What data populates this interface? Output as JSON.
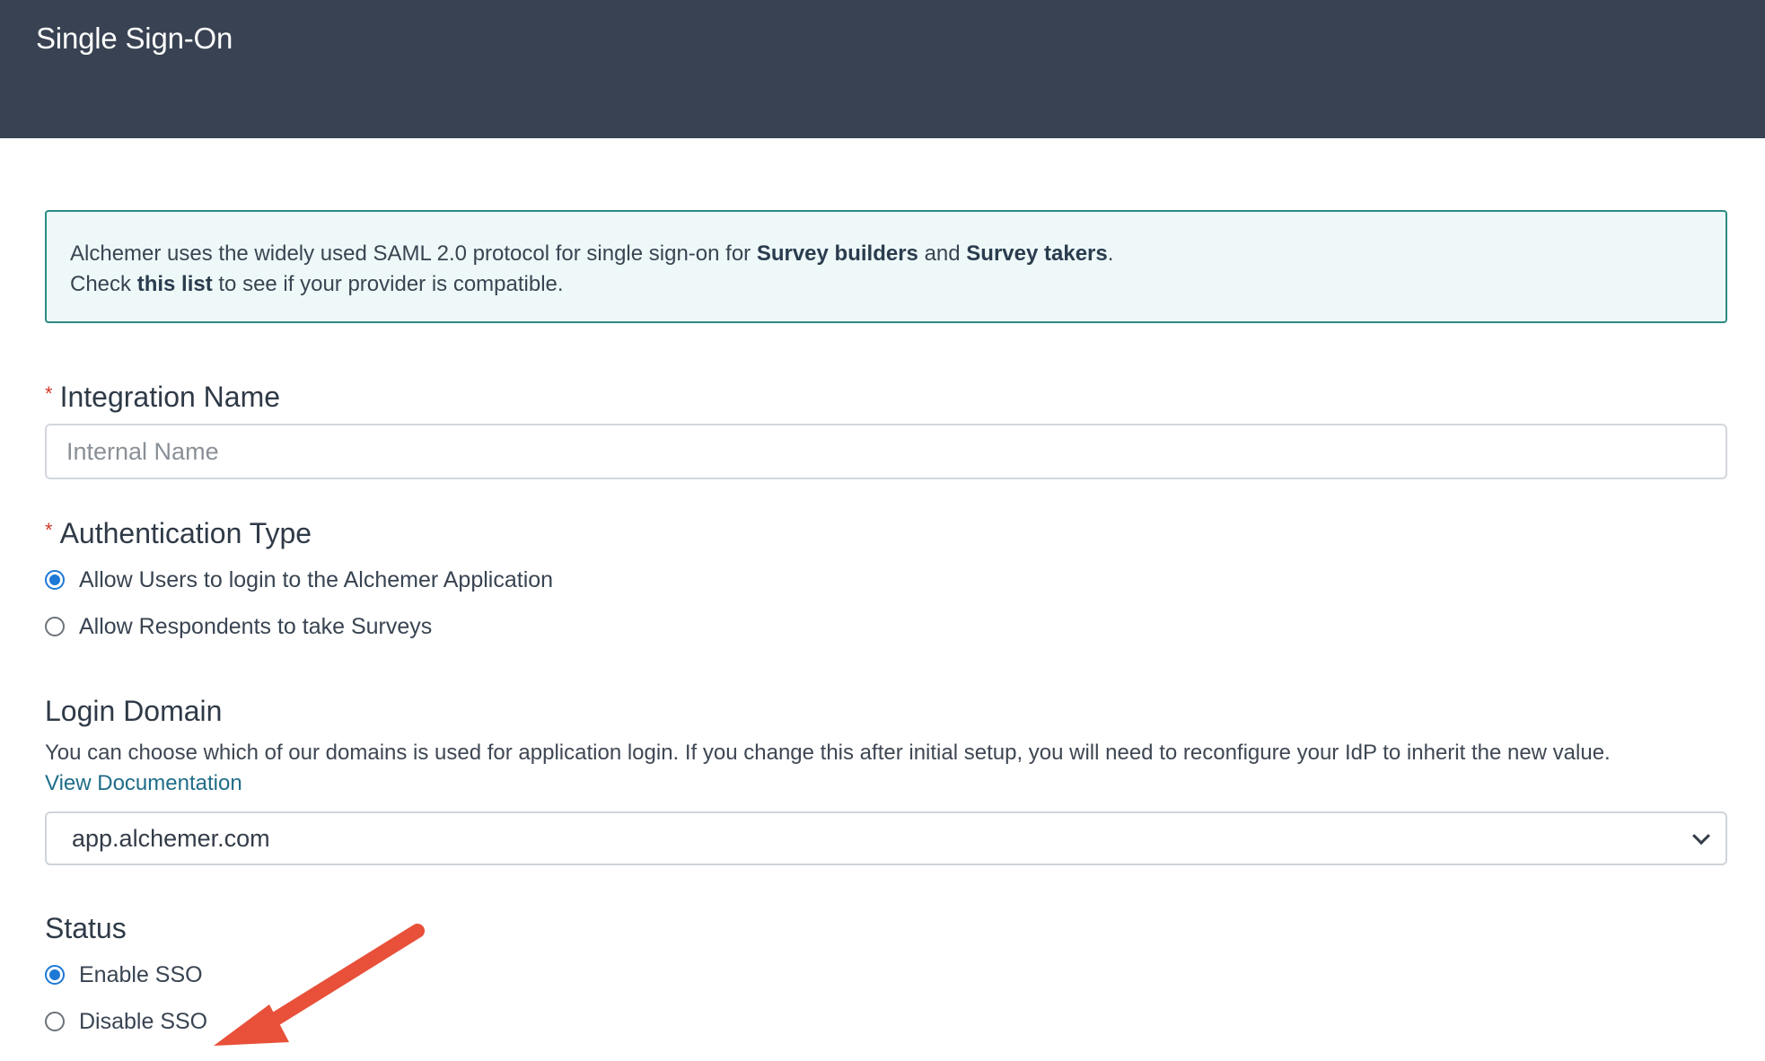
{
  "header": {
    "title": "Single Sign-On"
  },
  "info": {
    "line1_prefix": "Alchemer uses the widely used SAML 2.0 protocol for single sign-on for ",
    "survey_builders": "Survey builders",
    "and": " and ",
    "survey_takers": "Survey takers",
    "period": ".",
    "line2_prefix": "Check ",
    "this_list": "this list",
    "line2_suffix": " to see if your provider is compatible."
  },
  "integration_name": {
    "label": "Integration Name",
    "required_mark": "*",
    "placeholder": "Internal Name",
    "value": ""
  },
  "authentication_type": {
    "label": "Authentication Type",
    "required_mark": "*",
    "options": [
      {
        "label": "Allow Users to login to the Alchemer Application",
        "checked": true
      },
      {
        "label": "Allow Respondents to take Surveys",
        "checked": false
      }
    ]
  },
  "login_domain": {
    "label": "Login Domain",
    "help": "You can choose which of our domains is used for application login. If you change this after initial setup, you will need to reconfigure your IdP to inherit the new value.",
    "doc_link": "View Documentation",
    "selected": "app.alchemer.com"
  },
  "status": {
    "label": "Status",
    "options": [
      {
        "label": "Enable SSO",
        "checked": true
      },
      {
        "label": "Disable SSO",
        "checked": false
      }
    ]
  },
  "colors": {
    "header_bg": "#384252",
    "info_border": "#2a8a84",
    "radio_accent": "#1e78d6",
    "required": "#d23a2a",
    "arrow": "#e8503a"
  }
}
